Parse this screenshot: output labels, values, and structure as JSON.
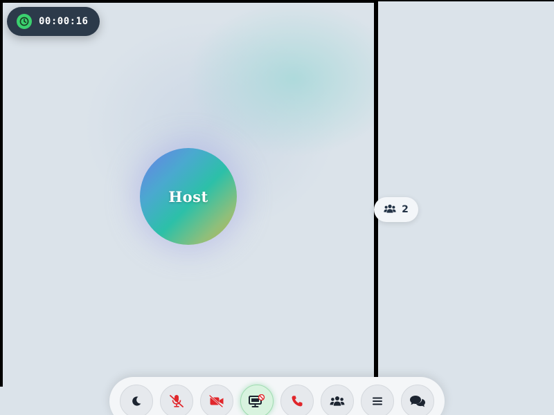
{
  "call": {
    "timer": "00:00:16",
    "host_label": "Host",
    "participant_count": "2"
  },
  "toolbar": {
    "buttons": [
      {
        "name": "theme-toggle-button",
        "icon": "moon-icon"
      },
      {
        "name": "microphone-button",
        "icon": "microphone-muted-icon",
        "state": "muted"
      },
      {
        "name": "camera-button",
        "icon": "video-off-icon",
        "state": "off"
      },
      {
        "name": "screen-share-button",
        "icon": "screen-share-blocked-icon",
        "state": "highlighted"
      },
      {
        "name": "end-call-button",
        "icon": "phone-icon"
      },
      {
        "name": "participants-button",
        "icon": "users-icon"
      },
      {
        "name": "menu-button",
        "icon": "hamburger-icon"
      },
      {
        "name": "chat-button",
        "icon": "chat-bubbles-icon"
      }
    ]
  },
  "colors": {
    "background": "#dbe3ea",
    "timer_bg": "#2c3a4a",
    "timer_icon": "#3bd16f",
    "danger_red": "#e0262b",
    "icon_dark": "#1c2430",
    "highlight_green": "#d8f3df"
  }
}
